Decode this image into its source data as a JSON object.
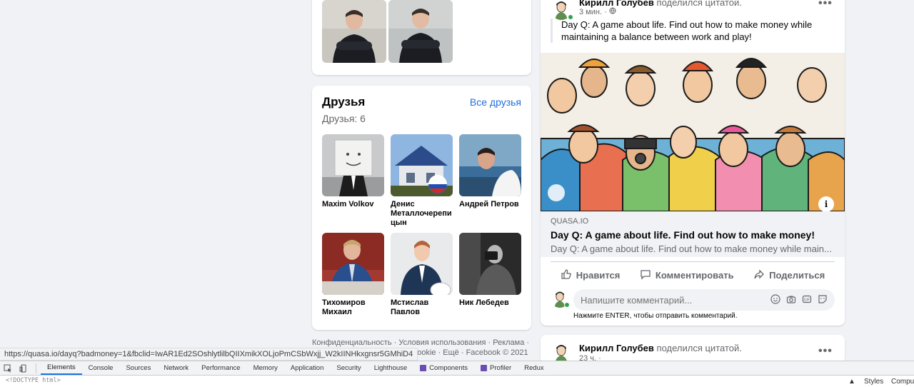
{
  "friends": {
    "title": "Друзья",
    "all_link": "Все друзья",
    "count": "Друзья: 6",
    "items": [
      {
        "name": "Maxim Volkov"
      },
      {
        "name": "Денис Металлочерепицын",
        "line1": "Денис",
        "line2": "Металлочерепи",
        "line3": "цын"
      },
      {
        "name": "Андрей Петров"
      },
      {
        "name": "Тихомиров Михаил",
        "line1": "Тихомиров",
        "line2": "Михаил"
      },
      {
        "name": "Мстислав Павлов",
        "line1": "Мстислав",
        "line2": "Павлов"
      },
      {
        "name": "Ник Лебедев"
      }
    ]
  },
  "footer": {
    "line1": "Конфиденциальность · Условия использования · Реклама ·",
    "line2": "· Файлы cookie · Ещё · Facebook © 2021"
  },
  "post": {
    "author": "Кирилл Голубев",
    "action": "поделился цитатой.",
    "time": "3 мин. ·",
    "quote": "Day Q: A game about life. Find out how to make money while maintaining a balance between work and play!",
    "link": {
      "domain": "QUASA.IO",
      "title": "Day Q: A game about life. Find out how to make money!",
      "description": "Day Q: A game about life. Find out how to make money while main..."
    },
    "actions": {
      "like": "Нравится",
      "comment": "Комментировать",
      "share": "Поделиться"
    },
    "comment_placeholder": "Напишите комментарий...",
    "comment_hint": "Нажмите ENTER, чтобы отправить комментарий."
  },
  "post2": {
    "author": "Кирилл Голубев",
    "action": "поделился цитатой.",
    "time": "23 ч. ·"
  },
  "status_url": "https://quasa.io/dayq?badmoney=1&fbclid=IwAR1Ed2SOshlytlilbQIIXmikXOLjoPmCSbWxjj_W2kIINHkxgnsr5GMhiD4",
  "devtools": {
    "tabs": [
      "Elements",
      "Console",
      "Sources",
      "Network",
      "Performance",
      "Memory",
      "Application",
      "Security",
      "Lighthouse",
      "Components",
      "Profiler",
      "Redux"
    ],
    "active_tab": "Elements",
    "doctype": "<!DOCTYPE html>",
    "right_styles": "Styles",
    "right_computed": "Comput"
  },
  "colors": {
    "accent": "#216fdb",
    "online": "#31a24c",
    "background": "#f0f2f5"
  }
}
